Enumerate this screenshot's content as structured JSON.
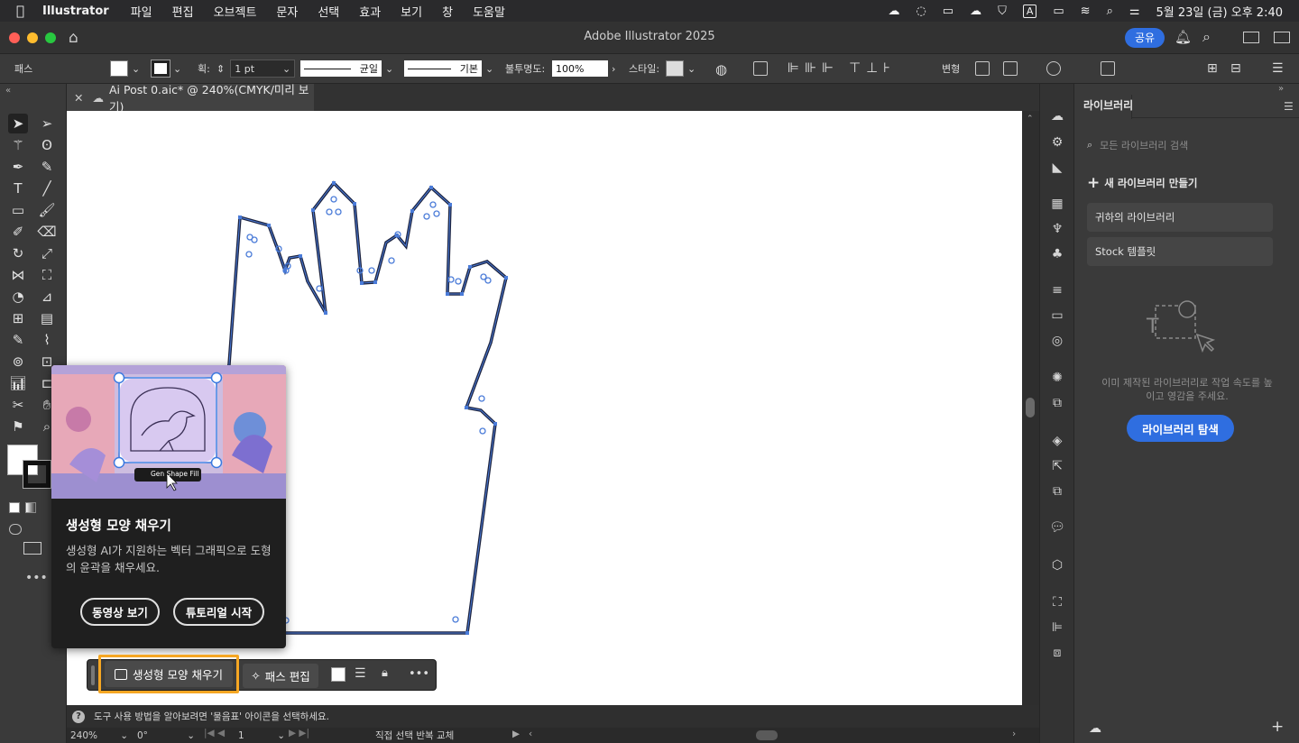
{
  "menubar": {
    "apple": "",
    "app": "Illustrator",
    "items": [
      "파일",
      "편집",
      "오브젝트",
      "문자",
      "선택",
      "효과",
      "보기",
      "창",
      "도움말"
    ],
    "datetime": "5월 23일 (금) 오후 2:40"
  },
  "titlebar": {
    "title": "Adobe Illustrator 2025",
    "share": "공유"
  },
  "control": {
    "path_label": "패스",
    "stroke_label": "획:",
    "stroke_value": "1 pt",
    "profile1": "균일",
    "profile2": "기본",
    "opacity_label": "불투명도:",
    "opacity_value": "100%",
    "style_label": "스타일:",
    "transform_label": "변형"
  },
  "doc": {
    "tab_title": "Ai Post 0.aic* @ 240%(CMYK/미리 보기)"
  },
  "popup": {
    "image_caption": "Gen Shape Fill",
    "title": "생성형 모양 채우기",
    "description": "생성형 AI가 지원하는 벡터 그래픽으로 도형의 윤곽을 채우세요.",
    "btn_video": "동영상 보기",
    "btn_tutorial": "튜토리얼 시작"
  },
  "contextbar": {
    "gen_fill": "생성형 모양 채우기",
    "edit_path": "패스 편집"
  },
  "library": {
    "tab": "라이브러리",
    "search_placeholder": "모든 라이브러리 검색",
    "new_library": "새 라이브러리 만들기",
    "your_libraries": "귀하의 라이브러리",
    "stock_templates": "Stock 템플릿",
    "empty_text": "이미 제작된 라이브러리로 작업 속도를 높이고 영감을 주세요.",
    "explore_btn": "라이브러리 탐색"
  },
  "status": {
    "hint": "도구 사용 방법을 알아보려면 '물음표' 아이콘을 선택하세요.",
    "zoom": "240%",
    "angle": "0°",
    "artboard": "1",
    "action": "직접 선택 반복 교체"
  },
  "colors": {
    "accent": "#2f6ee0",
    "highlight": "#f5a623",
    "anchor": "#4a7bd8"
  }
}
